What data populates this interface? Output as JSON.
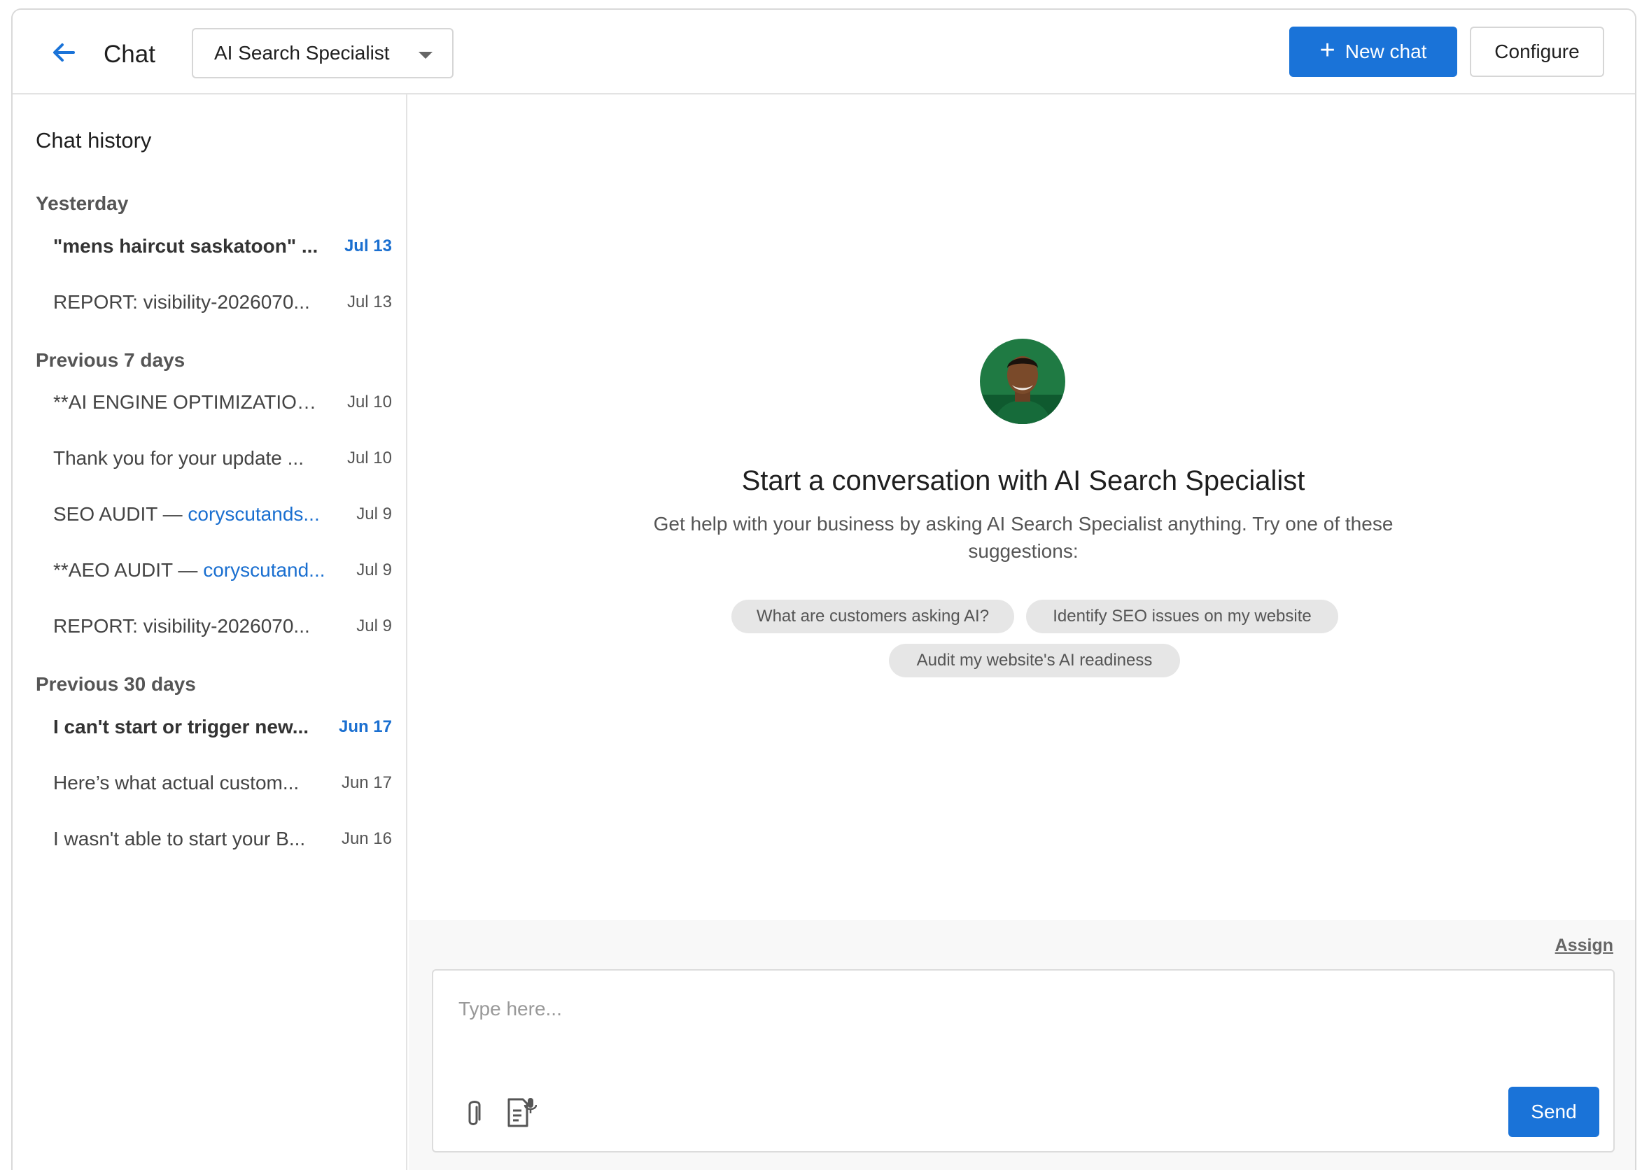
{
  "header": {
    "title": "Chat",
    "agent_selected": "AI Search Specialist",
    "new_chat_label": "New chat",
    "configure_label": "Configure"
  },
  "sidebar": {
    "title": "Chat history",
    "groups": [
      {
        "label": "Yesterday",
        "items": [
          {
            "text": "\"mens haircut saskatoon\" ...",
            "date": "Jul 13",
            "unread": true
          },
          {
            "text": "REPORT: visibility-2026070...",
            "date": "Jul 13",
            "unread": false
          }
        ]
      },
      {
        "label": "Previous 7 days",
        "items": [
          {
            "text": "**AI ENGINE OPTIMIZATION...",
            "date": "Jul 10",
            "unread": false
          },
          {
            "text": "Thank you for your update ...",
            "date": "Jul 10",
            "unread": false
          },
          {
            "text_prefix": "SEO AUDIT — ",
            "text_link": "coryscutands...",
            "date": "Jul 9",
            "unread": false
          },
          {
            "text_prefix": "**AEO AUDIT — ",
            "text_link": "coryscutand...",
            "date": "Jul 9",
            "unread": false
          },
          {
            "text": "REPORT: visibility-2026070...",
            "date": "Jul 9",
            "unread": false
          }
        ]
      },
      {
        "label": "Previous 30 days",
        "items": [
          {
            "text": "I can't start or trigger new...",
            "date": "Jun 17",
            "unread": true
          },
          {
            "text": "Here’s what actual custom...",
            "date": "Jun 17",
            "unread": false
          },
          {
            "text": "I wasn't able to start your B...",
            "date": "Jun 16",
            "unread": false
          }
        ]
      }
    ]
  },
  "main": {
    "heading": "Start a conversation with AI Search Specialist",
    "subtext": "Get help with your business by asking AI Search Specialist anything. Try one of these suggestions:",
    "suggestions": [
      "What are customers asking AI?",
      "Identify SEO issues on my website",
      "Audit my website's AI readiness"
    ]
  },
  "composer": {
    "assign_label": "Assign",
    "placeholder": "Type here...",
    "send_label": "Send"
  },
  "colors": {
    "accent": "#1a73d8",
    "link": "#1a6fd0",
    "avatar_bg": "#1f7a43"
  },
  "icons": [
    "back-arrow-icon",
    "chevron-down-icon",
    "plus-icon",
    "paperclip-icon",
    "dictate-icon"
  ]
}
